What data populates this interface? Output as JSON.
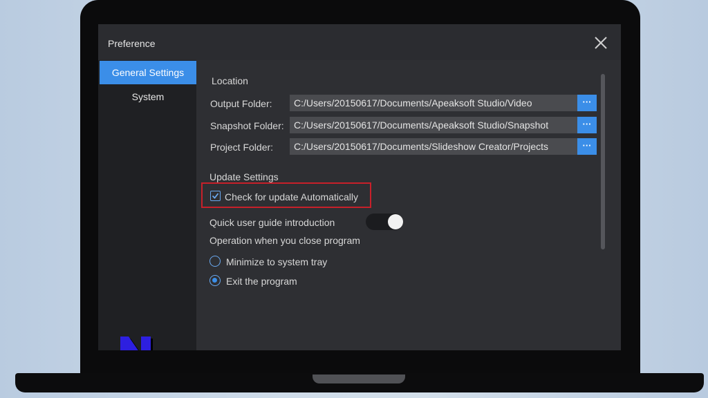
{
  "window": {
    "title": "Preference"
  },
  "sidebar": {
    "items": [
      {
        "label": "General Settings",
        "active": true
      },
      {
        "label": "System",
        "active": false
      }
    ],
    "logo_letter": "N"
  },
  "location": {
    "heading": "Location",
    "browse_label": "···",
    "rows": [
      {
        "label": "Output Folder:",
        "value": "C:/Users/20150617/Documents/Apeaksoft Studio/Video"
      },
      {
        "label": "Snapshot Folder:",
        "value": "C:/Users/20150617/Documents/Apeaksoft Studio/Snapshot"
      },
      {
        "label": "Project Folder:",
        "value": "C:/Users/20150617/Documents/Slideshow Creator/Projects"
      }
    ]
  },
  "update": {
    "heading": "Update Settings",
    "auto_check_label": "Check for update Automatically",
    "auto_check_checked": true,
    "guide_label": "Quick user guide introduction",
    "guide_on": true
  },
  "close_behavior": {
    "heading": "Operation when you close program",
    "options": [
      {
        "label": "Minimize to system tray",
        "selected": false
      },
      {
        "label": "Exit the program",
        "selected": true
      }
    ]
  },
  "colors": {
    "accent": "#3b8ee8",
    "highlight": "#c8202a",
    "logo_fill": "#2d1fe0"
  },
  "icons": {
    "close": "close-icon",
    "checkbox": "checkmark-icon",
    "logo": "n-logo-icon"
  }
}
